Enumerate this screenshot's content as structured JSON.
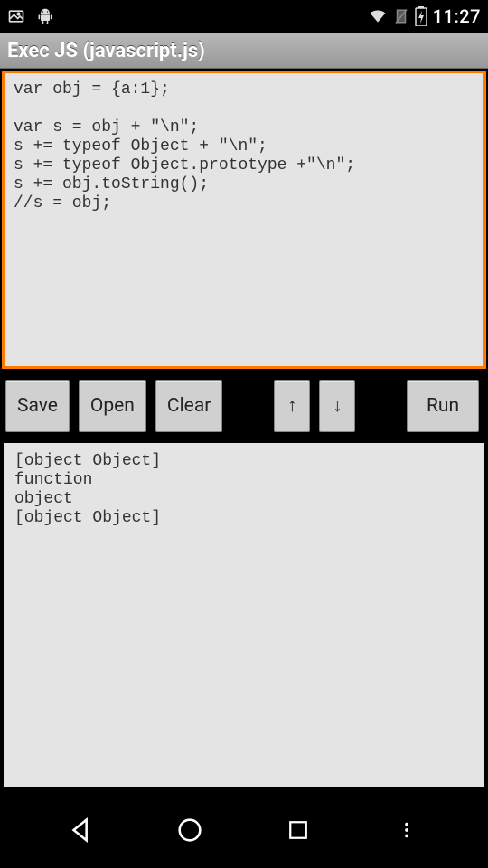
{
  "status": {
    "clock": "11:27"
  },
  "appbar": {
    "title": "Exec JS (javascript.js)"
  },
  "editor": {
    "code": "var obj = {a:1};\n\nvar s = obj + \"\\n\";\ns += typeof Object + \"\\n\";\ns += typeof Object.prototype +\"\\n\";\ns += obj.toString();\n//s = obj;"
  },
  "toolbar": {
    "save_label": "Save",
    "open_label": "Open",
    "clear_label": "Clear",
    "up_label": "↑",
    "down_label": "↓",
    "run_label": "Run"
  },
  "output": {
    "text": "[object Object]\nfunction\nobject\n[object Object]"
  }
}
